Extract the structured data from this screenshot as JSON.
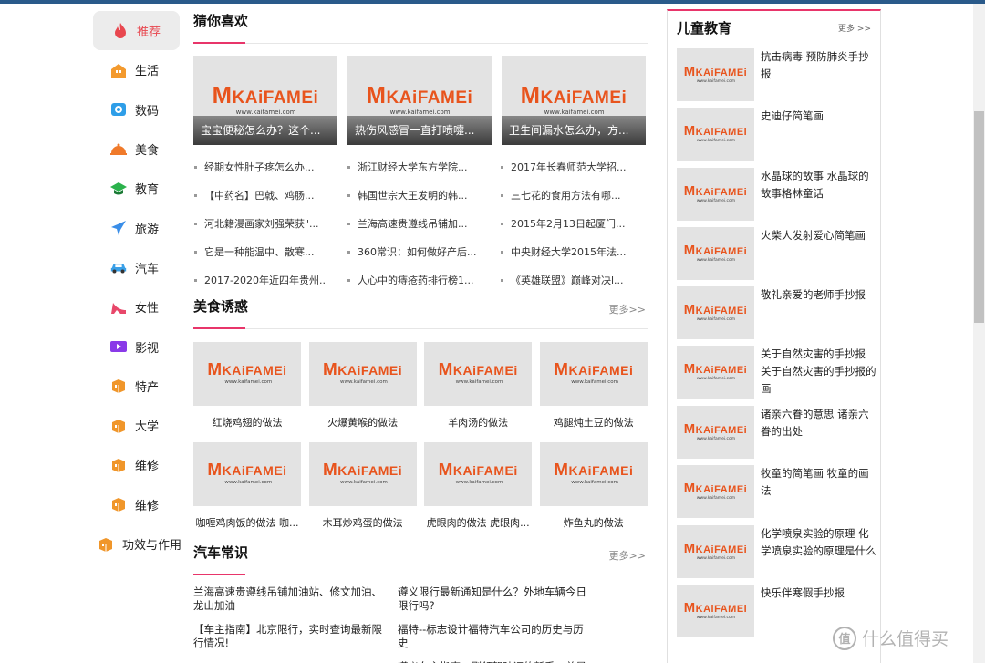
{
  "sidebar": {
    "items": [
      {
        "label": "推荐",
        "icon": "flame-icon",
        "color": "#e8474f"
      },
      {
        "label": "生活",
        "icon": "home-icon",
        "color": "#f39a2e"
      },
      {
        "label": "数码",
        "icon": "camera-icon",
        "color": "#2e9ee8"
      },
      {
        "label": "美食",
        "icon": "food-cover-icon",
        "color": "#f07a2a"
      },
      {
        "label": "教育",
        "icon": "graduation-cap-icon",
        "color": "#2bb24c"
      },
      {
        "label": "旅游",
        "icon": "airplane-icon",
        "color": "#3a8ee8"
      },
      {
        "label": "汽车",
        "icon": "car-icon",
        "color": "#3aa0e8"
      },
      {
        "label": "女性",
        "icon": "high-heel-icon",
        "color": "#e8476a"
      },
      {
        "label": "影视",
        "icon": "video-icon",
        "color": "#8a3ae8"
      },
      {
        "label": "特产",
        "icon": "box-icon",
        "color": "#f0962a"
      },
      {
        "label": "大学",
        "icon": "box-icon",
        "color": "#f0962a"
      },
      {
        "label": "维修",
        "icon": "box-icon",
        "color": "#f0962a"
      },
      {
        "label": "维修",
        "icon": "box-icon",
        "color": "#f0962a"
      },
      {
        "label": "功效与作用",
        "icon": "box-icon",
        "color": "#f0962a"
      }
    ]
  },
  "logo": {
    "letter": "M",
    "rest": "KAiFAMEi",
    "url": "www.kaifamei.com"
  },
  "recommend": {
    "title": "猜你喜欢",
    "cards": [
      {
        "caption": "宝宝便秘怎么办？这个..."
      },
      {
        "caption": "热伤风感冒一直打喷嚏..."
      },
      {
        "caption": "卫生间漏水怎么办，方..."
      }
    ],
    "lists": [
      [
        "经期女性肚子疼怎么办...",
        "【中药名】巴戟、鸡肠...",
        "河北籍漫画家刘强荣获\"...",
        "它是一种能温中、散寒...",
        "2017-2020年近四年贵州..."
      ],
      [
        "浙江财经大学东方学院...",
        "韩国世宗大王发明的韩...",
        "兰海高速贵遵线吊铺加...",
        "360常识：如何做好产后...",
        "人心中的痔疮药排行榜1..."
      ],
      [
        "2017年长春师范大学招...",
        "三七花的食用方法有哪...",
        "2015年2月13日起厦门...",
        "中央财经大学2015年法...",
        "《英雄联盟》巅峰对决l..."
      ]
    ]
  },
  "food": {
    "title": "美食诱惑",
    "more": "更多>>",
    "items": [
      "红烧鸡翅的做法",
      "火爆黄喉的做法",
      "羊肉汤的做法",
      "鸡腿炖土豆的做法",
      "咖喱鸡肉饭的做法 咖...",
      "木耳炒鸡蛋的做法",
      "虎眼肉的做法 虎眼肉...",
      "炸鱼丸的做法"
    ]
  },
  "car": {
    "title": "汽车常识",
    "more": "更多>>",
    "items": [
      "兰海高速贵遵线吊铺加油站、修文加油、龙山加油",
      "遵义限行最新通知是什么？外地车辆今日限行吗?",
      "【车主指南】北京限行，实时查询最新限行情况!",
      "福特--标志设计福特汽车公司的历史与历史",
      "",
      "遵义车主指南：刚领驾驶证的新手，总是疑"
    ]
  },
  "right": {
    "title": "儿童教育",
    "more": "更多 >>",
    "items": [
      "抗击病毒 预防肺炎手抄报",
      "史迪仔简笔画",
      "水晶球的故事 水晶球的故事格林童话",
      "火柴人发射爱心简笔画",
      "敬礼亲爱的老师手抄报",
      "关于自然灾害的手抄报 关于自然灾害的手抄报的画",
      "诸亲六眷的意思 诸亲六眷的出处",
      "牧童的简笔画 牧童的画法",
      "化学喷泉实验的原理 化学喷泉实验的原理是什么",
      "快乐伴寒假手抄报"
    ]
  },
  "watermark": {
    "badge": "值",
    "text": "什么值得买"
  },
  "colors": {
    "accent": "#e8356a",
    "brand": "#e8541d",
    "topbar": "#2a5a8a"
  }
}
